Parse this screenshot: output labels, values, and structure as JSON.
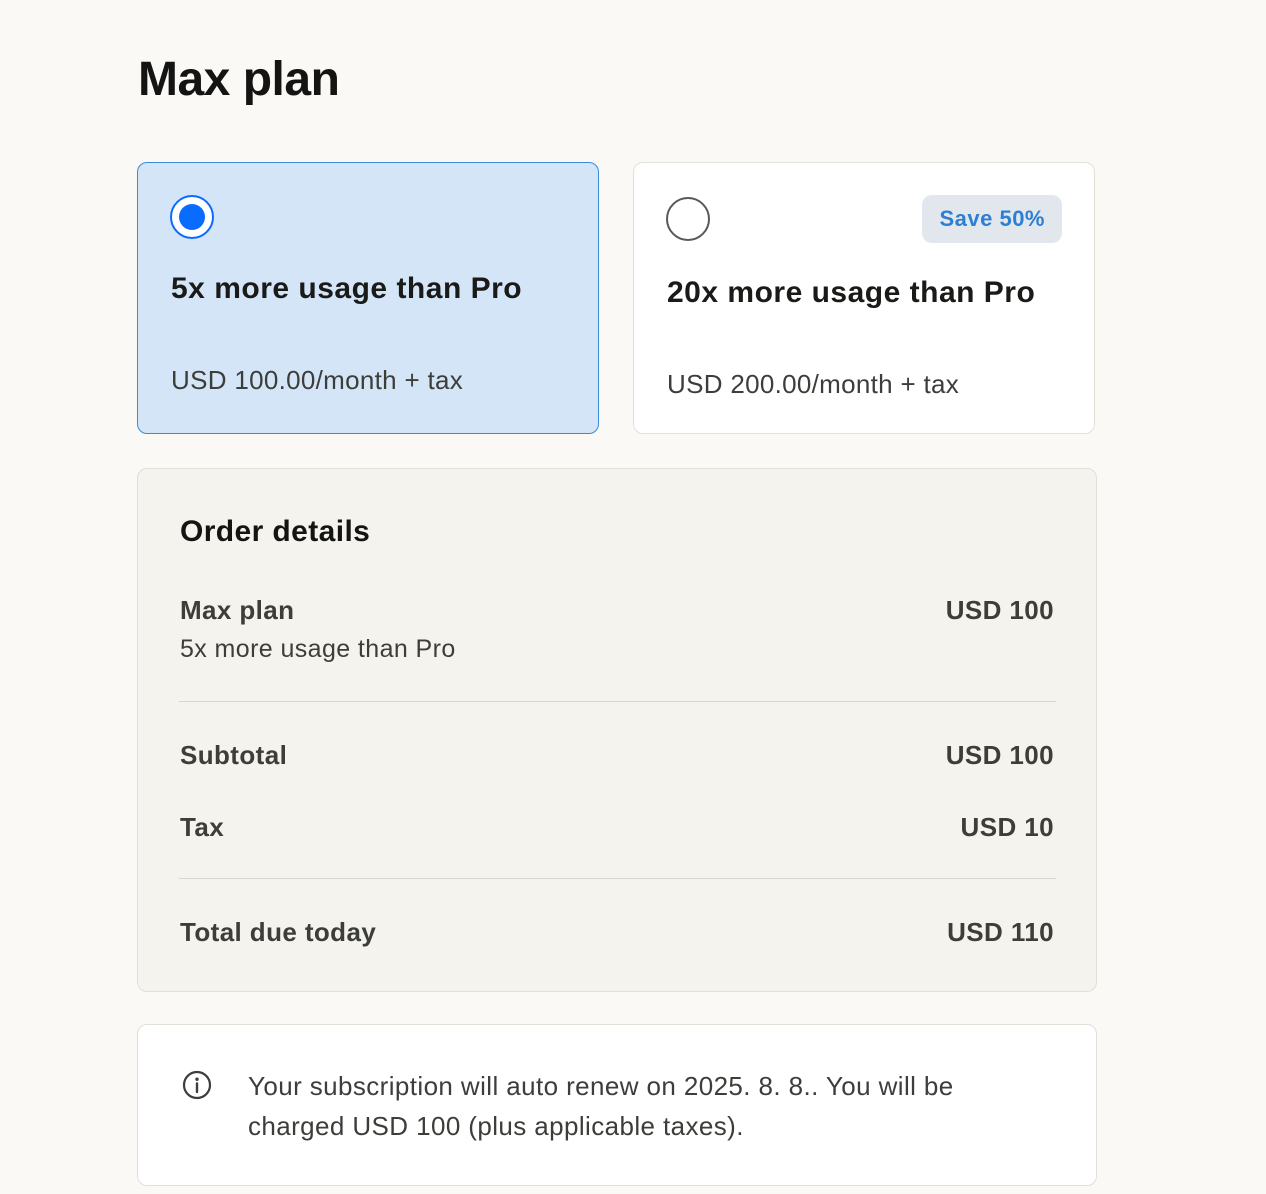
{
  "page": {
    "title": "Max plan"
  },
  "plans": [
    {
      "name": "5x more usage than Pro",
      "price": "USD 100.00/month + tax",
      "selected": true
    },
    {
      "name": "20x more usage than Pro",
      "price": "USD 200.00/month + tax",
      "badge": "Save 50%",
      "selected": false
    }
  ],
  "order": {
    "title": "Order details",
    "item_label": "Max plan",
    "item_description": "5x more usage than Pro",
    "item_price": "USD 100",
    "subtotal_label": "Subtotal",
    "subtotal_value": "USD 100",
    "tax_label": "Tax",
    "tax_value": "USD 10",
    "total_label": "Total due today",
    "total_value": "USD 110"
  },
  "notice": {
    "icon": "info-icon",
    "text": "Your subscription will auto renew on 2025. 8. 8.. You will be charged USD 100 (plus applicable taxes)."
  },
  "colors": {
    "accent": "#0a6cff",
    "selected_card_bg": "#d3e5f7",
    "badge_text": "#2d7fd4",
    "page_bg": "#faf9f5"
  }
}
